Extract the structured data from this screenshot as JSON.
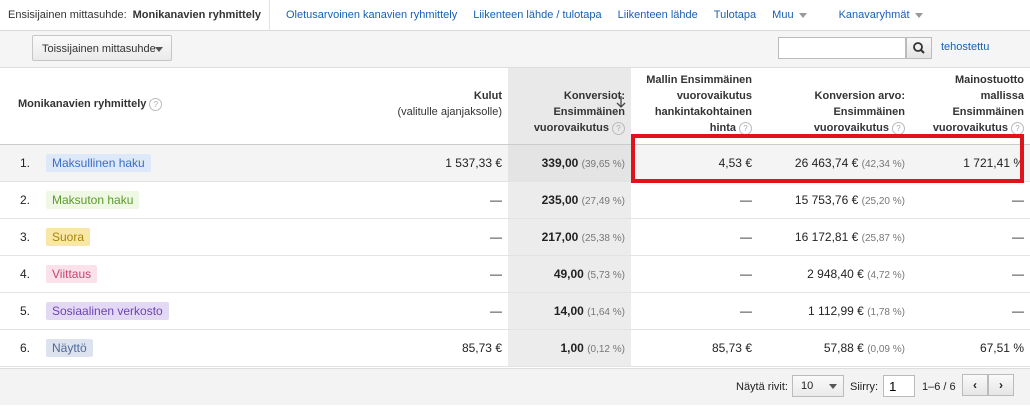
{
  "top_tabs": {
    "primary_label": "Ensisijainen mittasuhde:",
    "current": "Monikanavien ryhmittely",
    "links": [
      "Oletusarvoinen kanavien ryhmittely",
      "Liikenteen lähde / tulotapa",
      "Liikenteen lähde",
      "Tulotapa",
      "Muu",
      "Kanavaryhmät"
    ]
  },
  "toolbar": {
    "secondary_dimension": "Toissijainen mittasuhde",
    "search_placeholder": "",
    "advanced_link": "tehostettu"
  },
  "columns": {
    "dimension": "Monikanavien ryhmittely",
    "cost_line1": "Kulut",
    "cost_line2": "(valitulle ajanjaksolle)",
    "conv_line1": "Konversiot:",
    "conv_line2": "Ensimmäinen",
    "conv_line3": "vuorovaikutus",
    "cpa_line1": "Mallin Ensimmäinen",
    "cpa_line2": "vuorovaikutus",
    "cpa_line3": "hankintakohtainen",
    "cpa_line4": "hinta",
    "value_line1": "Konversion arvo:",
    "value_line2": "Ensimmäinen",
    "value_line3": "vuorovaikutus",
    "roas_line1": "Mainostuotto",
    "roas_line2": "mallissa",
    "roas_line3": "Ensimmäinen",
    "roas_line4": "vuorovaikutus"
  },
  "rows": [
    {
      "n": "1.",
      "name": "Maksullinen haku",
      "bg": "#dde8f8",
      "fg": "#3a6fc4",
      "cost": "1 537,33 €",
      "conv": "339,00",
      "conv_pct": "(39,65 %)",
      "cpa": "4,53 €",
      "value": "26 463,74 €",
      "value_pct": "(42,34 %)",
      "roas": "1 721,41 %"
    },
    {
      "n": "2.",
      "name": "Maksuton haku",
      "bg": "#eef8e4",
      "fg": "#5b9a2c",
      "cost": "—",
      "conv": "235,00",
      "conv_pct": "(27,49 %)",
      "cpa": "—",
      "value": "15 753,76 €",
      "value_pct": "(25,20 %)",
      "roas": "—"
    },
    {
      "n": "3.",
      "name": "Suora",
      "bg": "#f9e7a8",
      "fg": "#a8860a",
      "cost": "—",
      "conv": "217,00",
      "conv_pct": "(25,38 %)",
      "cpa": "—",
      "value": "16 172,81 €",
      "value_pct": "(25,87 %)",
      "roas": "—"
    },
    {
      "n": "4.",
      "name": "Viittaus",
      "bg": "#fbe1ea",
      "fg": "#c2476e",
      "cost": "—",
      "conv": "49,00",
      "conv_pct": "(5,73 %)",
      "cpa": "—",
      "value": "2 948,40 €",
      "value_pct": "(4,72 %)",
      "roas": "—"
    },
    {
      "n": "5.",
      "name": "Sosiaalinen verkosto",
      "bg": "#e4d9f4",
      "fg": "#6e44b2",
      "cost": "—",
      "conv": "14,00",
      "conv_pct": "(1,64 %)",
      "cpa": "—",
      "value": "1 112,99 €",
      "value_pct": "(1,78 %)",
      "roas": "—"
    },
    {
      "n": "6.",
      "name": "Näyttö",
      "bg": "#dde3ee",
      "fg": "#4f6a9a",
      "cost": "85,73 €",
      "conv": "1,00",
      "conv_pct": "(0,12 %)",
      "cpa": "85,73 €",
      "value": "57,88 €",
      "value_pct": "(0,09 %)",
      "roas": "67,51 %"
    }
  ],
  "footer": {
    "show_rows_label": "Näytä rivit:",
    "rows_value": "10",
    "goto_label": "Siirry:",
    "page_value": "1",
    "range": "1–6 / 6"
  },
  "icons": [
    "help-icon",
    "search-icon",
    "sort-down-icon",
    "chevron-left-icon",
    "chevron-right-icon",
    "caret-down-icon"
  ]
}
